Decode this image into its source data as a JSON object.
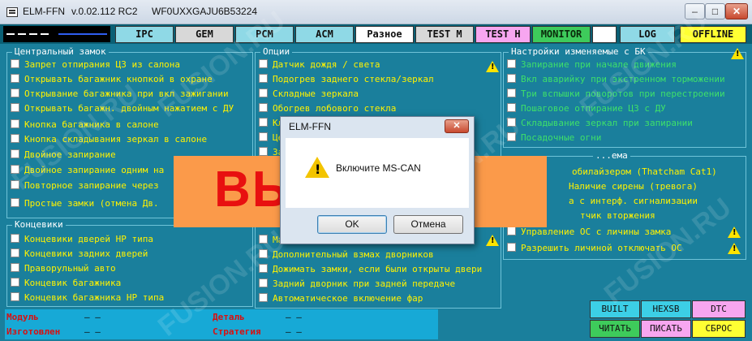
{
  "window": {
    "app_name": "ELM-FFN",
    "version": "v.0.02.112 RC2",
    "vin": "WF0UXXGAJU6B53224",
    "minimize_label": "–",
    "maximize_label": "□",
    "close_label": "✕"
  },
  "toolbar": {
    "tabs": [
      "IPC",
      "GEM",
      "PCM",
      "ACM",
      "Разное",
      "TEST M",
      "TEST H",
      "MONITOR",
      "",
      "LOG",
      "OFFLINE"
    ]
  },
  "central_lock": {
    "title": "Центральный замок",
    "items": [
      "Запрет отпирания ЦЗ из салона",
      "Открывать багажник кнопкой в охране",
      "Открывание багажника при вкл зажигании",
      "Открывать багажн. двойным нажатием с ДУ",
      "Кнопка багажника в салоне",
      "Кнопка складывания зеркал в салоне",
      "Двойное запирание",
      "Двойное запирание одним на",
      "Повторное запирание через",
      "Простые замки (отмена Дв."
    ]
  },
  "switches": {
    "title": "Концевики",
    "items": [
      "Концевики дверей НР типа",
      "Концевики задних дверей",
      "Праворульный авто",
      "Концевик багажника",
      "Концевик багажника НР типа"
    ]
  },
  "options": {
    "title": "Опции",
    "items": [
      "Датчик дождя / света",
      "Подогрев заднего стекла/зеркал",
      "Складные зеркала",
      "Обогрев лобового стекла",
      "Кл",
      "Це",
      "За",
      "Н",
      "",
      "",
      "",
      "Ма",
      "Дополнительный взмах дворников",
      "Дожимать замки, если были открыты двери",
      "Задний дворник при задней передаче",
      "Автоматическое включение фар"
    ]
  },
  "bk_settings": {
    "title": "Настройки изменяемые с БК",
    "items": [
      "Запирание при начале движения",
      "Вкл аварийку при экстренном торможении",
      "Три вспышки поворотов при перестроении",
      "Пошаговое отпирание ЦЗ с ДУ",
      "Складывание зеркал при запирании",
      "Посадочные огни"
    ]
  },
  "alarm": {
    "title": "...ема",
    "items": [
      "обилайзером (Thatcham Cat1)",
      "Наличие сирены (тревога)",
      "а с интерф. сигнализации",
      "тчик вторжения",
      "Управление ОС с личины замка",
      "Разрешить личиной отключать ОС"
    ]
  },
  "info": {
    "module_label": "Модуль",
    "module_value": "– –",
    "made_label": "Изготовлен",
    "made_value": "– –",
    "part_label": "Деталь",
    "part_value": "– –",
    "strategy_label": "Стратегия",
    "strategy_value": "– –"
  },
  "bottom_buttons": {
    "built": "BUILT",
    "hex": "HEXSB",
    "dtc": "DTC",
    "read": "ЧИТАТЬ",
    "write": "ПИСАТЬ",
    "reset": "СБРОС"
  },
  "banner": {
    "text": "ВЫ ЛЮ"
  },
  "watermark": {
    "text": "FUSION.RU"
  },
  "dialog": {
    "title": "ELM-FFN",
    "message": "Включите MS-CAN",
    "ok": "OK",
    "cancel": "Отмена",
    "close_label": "✕"
  },
  "colors": {
    "background": "#1a7f9c",
    "text_yellow": "#fff200",
    "text_green": "#3ee06a",
    "label_red": "#d81010",
    "banner_orange": "#fb9a4a"
  }
}
